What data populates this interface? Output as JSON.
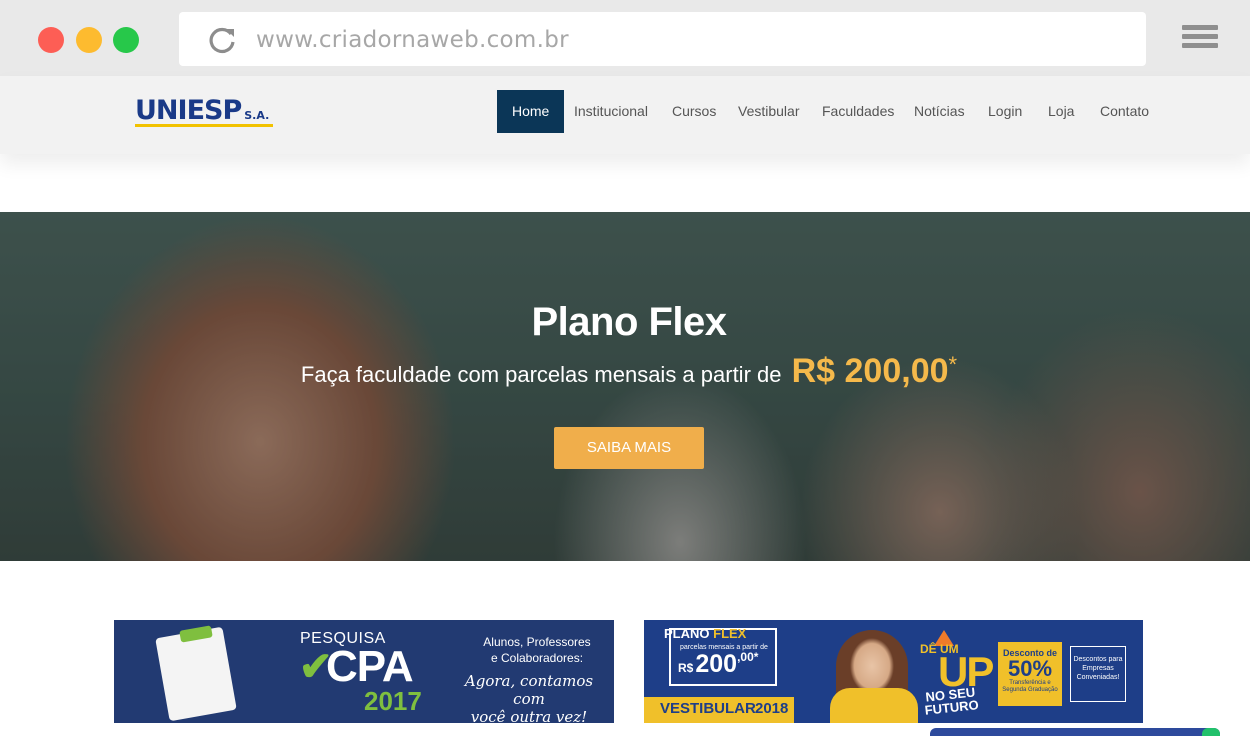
{
  "browser": {
    "url": "www.criadornaweb.com.br",
    "icons": {
      "reload": "reload-icon",
      "menu": "hamburger-menu-icon"
    },
    "colors": {
      "close": "#fd5e55",
      "minimize": "#fdbb2f",
      "maximize": "#27c84a"
    }
  },
  "header": {
    "logo_text": "UNIESP",
    "logo_suffix": "S.A.",
    "nav": [
      {
        "label": "Home",
        "active": true
      },
      {
        "label": "Institucional",
        "active": false
      },
      {
        "label": "Cursos",
        "active": false
      },
      {
        "label": "Vestibular",
        "active": false
      },
      {
        "label": "Faculdades",
        "active": false
      },
      {
        "label": "Notícias",
        "active": false
      },
      {
        "label": "Login",
        "active": false
      },
      {
        "label": "Loja",
        "active": false
      },
      {
        "label": "Contato",
        "active": false
      }
    ],
    "colors": {
      "active_bg": "#0b3657",
      "logo": "#1a3a88"
    }
  },
  "hero": {
    "title": "Plano Flex",
    "subtitle": "Faça faculdade com parcelas mensais a partir de",
    "price": "R$ 200,00",
    "price_mark": "*",
    "button_label": "SAIBA MAIS",
    "colors": {
      "accent": "#f0ae4b"
    }
  },
  "banners": {
    "cpa": {
      "kicker": "PESQUISA",
      "check": "✔",
      "title": "CPA",
      "year": "2017",
      "audience_line1": "Alunos, Professores",
      "audience_line2": "e Colaboradores:",
      "slogan_line1": "Agora, contamos com",
      "slogan_line2": "você outra vez!"
    },
    "flex": {
      "title_a": "PLANO",
      "title_b": "FLEX",
      "small_text": "parcelas mensais a partir de",
      "price_prefix": "R$",
      "price": "200",
      "price_cents": ",00*",
      "vestibular": "VESTIBULAR",
      "vestibular_year": "2018",
      "de_um": "DÊ UM",
      "up": "UP",
      "futuro": "NO SEU FUTURO",
      "discount_label": "Desconto de",
      "discount_value": "50%",
      "discount_note": "Transferência e Segunda Graduação",
      "conv_text": "Descontos para Empresas Conveniadas!"
    }
  }
}
